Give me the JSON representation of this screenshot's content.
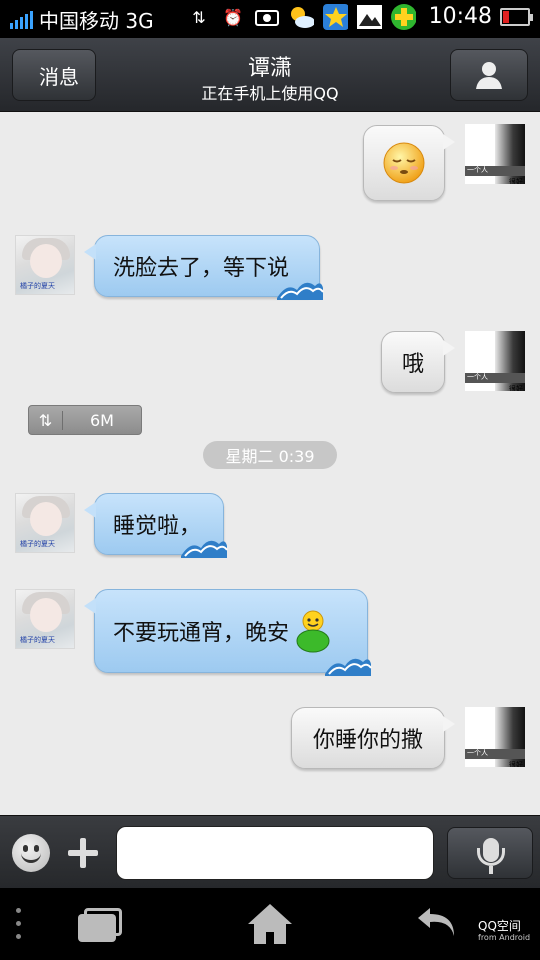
{
  "status_bar": {
    "carrier": "中国移动 3G",
    "time": "10:48"
  },
  "header": {
    "back_label": "消息",
    "contact_name": "谭潇",
    "contact_status": "正在手机上使用QQ"
  },
  "messages": [
    {
      "side": "out",
      "type": "emoji",
      "emoji": "sleepy-face"
    },
    {
      "side": "in",
      "text": "洗脸去了，等下说"
    },
    {
      "side": "out",
      "text": "哦"
    },
    {
      "side": "in",
      "text": "睡觉啦，"
    },
    {
      "side": "in",
      "text": "不要玩通宵，晚安"
    },
    {
      "side": "out",
      "text": "你睡你的撒"
    }
  ],
  "file_transfer": {
    "size": "6M"
  },
  "time_divider": "星期二 0:39",
  "avatars": {
    "other_caption": "橘子的夏天",
    "me_caption_1": "一个人",
    "me_caption_2": "很好"
  },
  "input": {
    "value": "",
    "placeholder": ""
  },
  "nav": {
    "qqzone_label": "QQ空间",
    "qqzone_sub": "from Android"
  },
  "colors": {
    "incoming_bubble": "#a9d2f4",
    "outgoing_bubble": "#eeeeee",
    "chat_background": "#ebebeb",
    "signal_blue": "#3aa3ff"
  }
}
